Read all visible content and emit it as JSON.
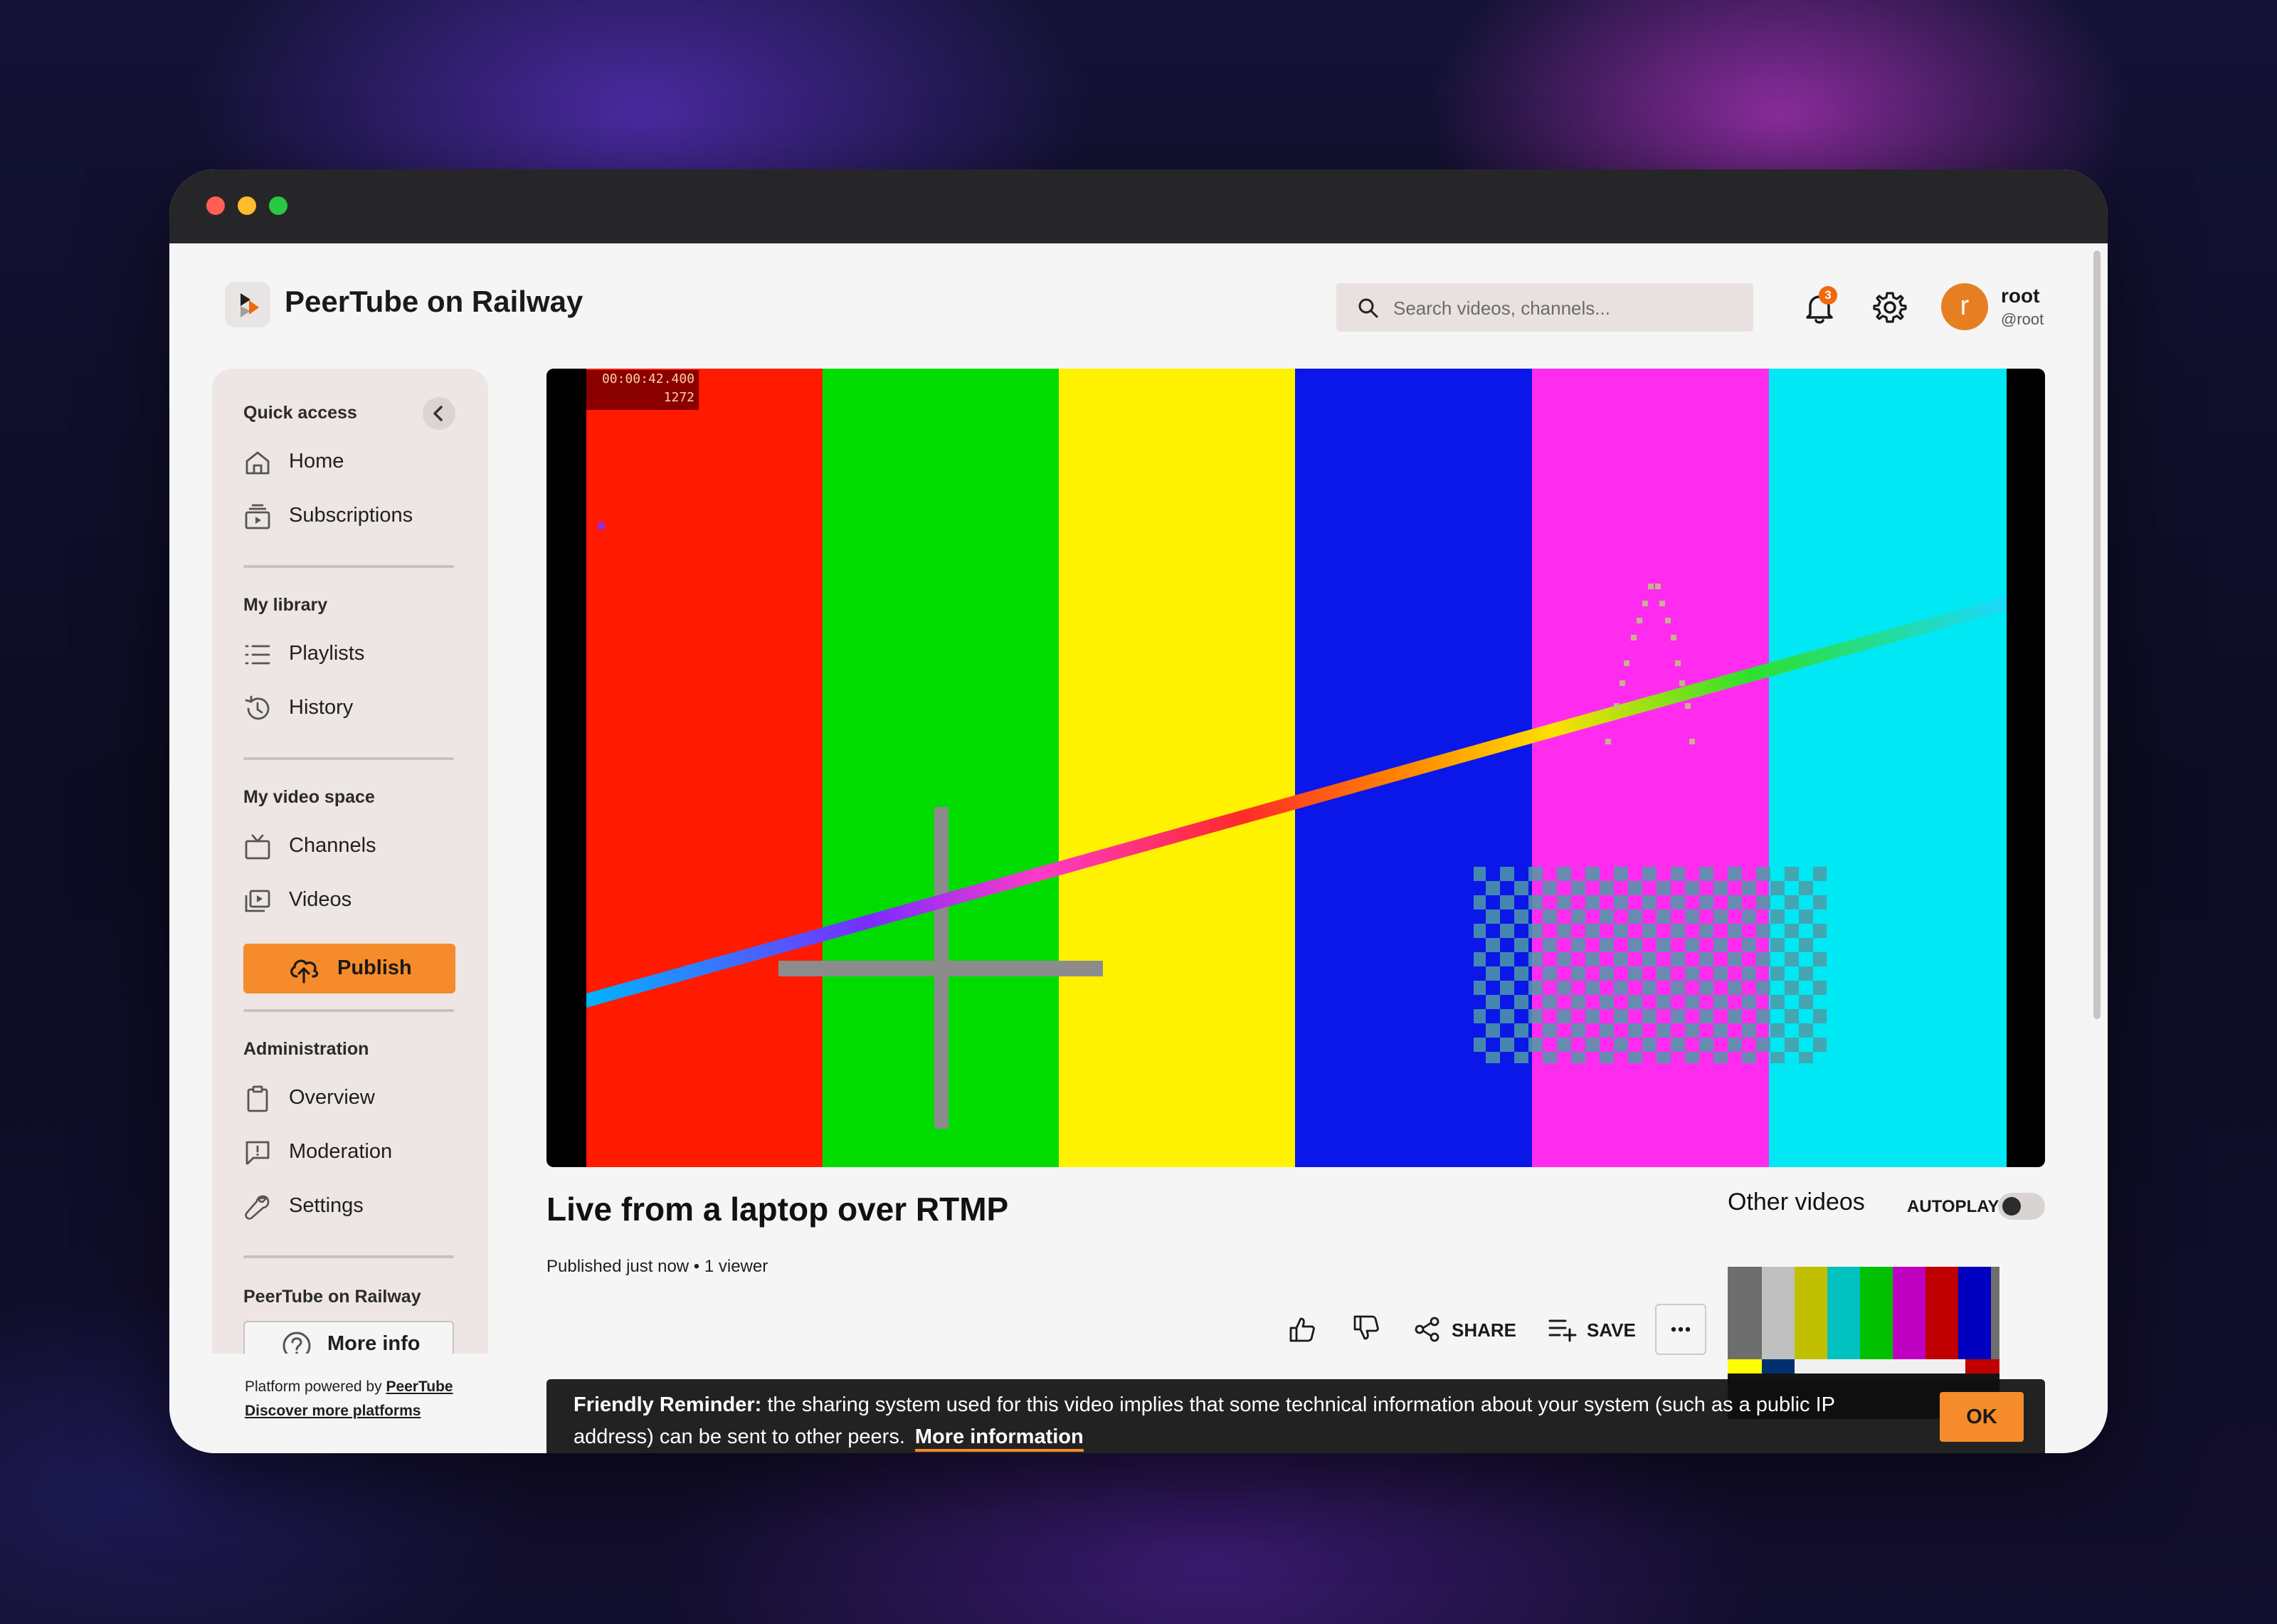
{
  "header": {
    "site_title": "PeerTube on Railway",
    "search_placeholder": "Search videos, channels...",
    "notification_count": "3",
    "user": {
      "avatar_letter": "r",
      "name": "root",
      "handle": "@root"
    }
  },
  "sidebar": {
    "sections": [
      {
        "heading": "Quick access",
        "items": [
          {
            "label": "Home",
            "icon": "home-icon"
          },
          {
            "label": "Subscriptions",
            "icon": "subscriptions-icon"
          }
        ]
      },
      {
        "heading": "My library",
        "items": [
          {
            "label": "Playlists",
            "icon": "list-icon"
          },
          {
            "label": "History",
            "icon": "history-icon"
          }
        ]
      },
      {
        "heading": "My video space",
        "items": [
          {
            "label": "Channels",
            "icon": "tv-icon"
          },
          {
            "label": "Videos",
            "icon": "video-icon"
          }
        ]
      },
      {
        "heading": "Administration",
        "items": [
          {
            "label": "Overview",
            "icon": "clipboard-icon"
          },
          {
            "label": "Moderation",
            "icon": "flag-message-icon"
          },
          {
            "label": "Settings",
            "icon": "wrench-icon"
          }
        ]
      },
      {
        "heading": "PeerTube on Railway",
        "items": []
      }
    ],
    "publish_label": "Publish",
    "more_info_label": "More info",
    "footer": {
      "powered_prefix": "Platform powered by",
      "powered_link": "PeerTube",
      "discover_link": "Discover more platforms"
    }
  },
  "player": {
    "timecode": "00:00:42.400",
    "frame": "1272",
    "test_pattern_colors": [
      "#ff1a00",
      "#00dc00",
      "#fff200",
      "#0a17e8",
      "#ff2cf0",
      "#00e8f4"
    ]
  },
  "video": {
    "title": "Live from a laptop over RTMP",
    "meta": "Published just now • 1 viewer",
    "actions": {
      "share": "SHARE",
      "save": "SAVE"
    }
  },
  "related": {
    "heading": "Other videos",
    "autoplay_label": "AUTOPLAY",
    "autoplay_on": false
  },
  "banner": {
    "bold_prefix": "Friendly Reminder:",
    "message": " the sharing system used for this video implies that some technical information about your system (such as a public IP address) can be sent to other peers.",
    "link": "More information",
    "ok": "OK"
  },
  "colors": {
    "accent": "#f58b2a",
    "sidebar_bg": "#ede6e5",
    "page_bg": "#f6f5f5"
  }
}
